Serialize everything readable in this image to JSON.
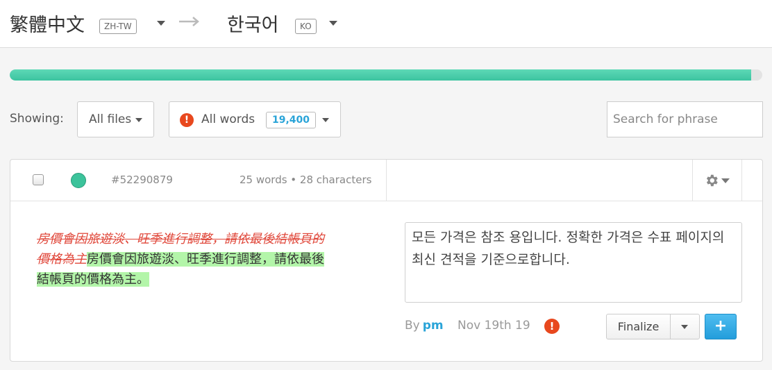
{
  "languages": {
    "source_name": "繁體中文",
    "source_code": "ZH-TW",
    "target_name": "한국어",
    "target_code": "KO"
  },
  "progress": {
    "fraction": 0.985,
    "color": "#3cc4a0"
  },
  "filters": {
    "showing_label": "Showing:",
    "files_label": "All files",
    "words_label": "All words",
    "words_count": "19,400",
    "search_placeholder": "Search for phrase"
  },
  "segment": {
    "id": "#52290879",
    "stats": "25 words • 28 characters",
    "status_color": "#3cc39b",
    "source_deleted": "房價會因旅遊淡、旺季進行調整，請依最後結帳頁的價格為主",
    "source_added": "房價會因旅遊淡、旺季進行調整，請依最後結帳頁的價格為主。",
    "target_text": "모든 가격은 참조 용입니다. 정확한 가격은 수표 페이지의 최신 견적을 기준으로합니다.",
    "by_label": "By",
    "user": "pm",
    "date": "Nov 19th 19",
    "finalize_label": "Finalize",
    "plus_label": "+"
  }
}
